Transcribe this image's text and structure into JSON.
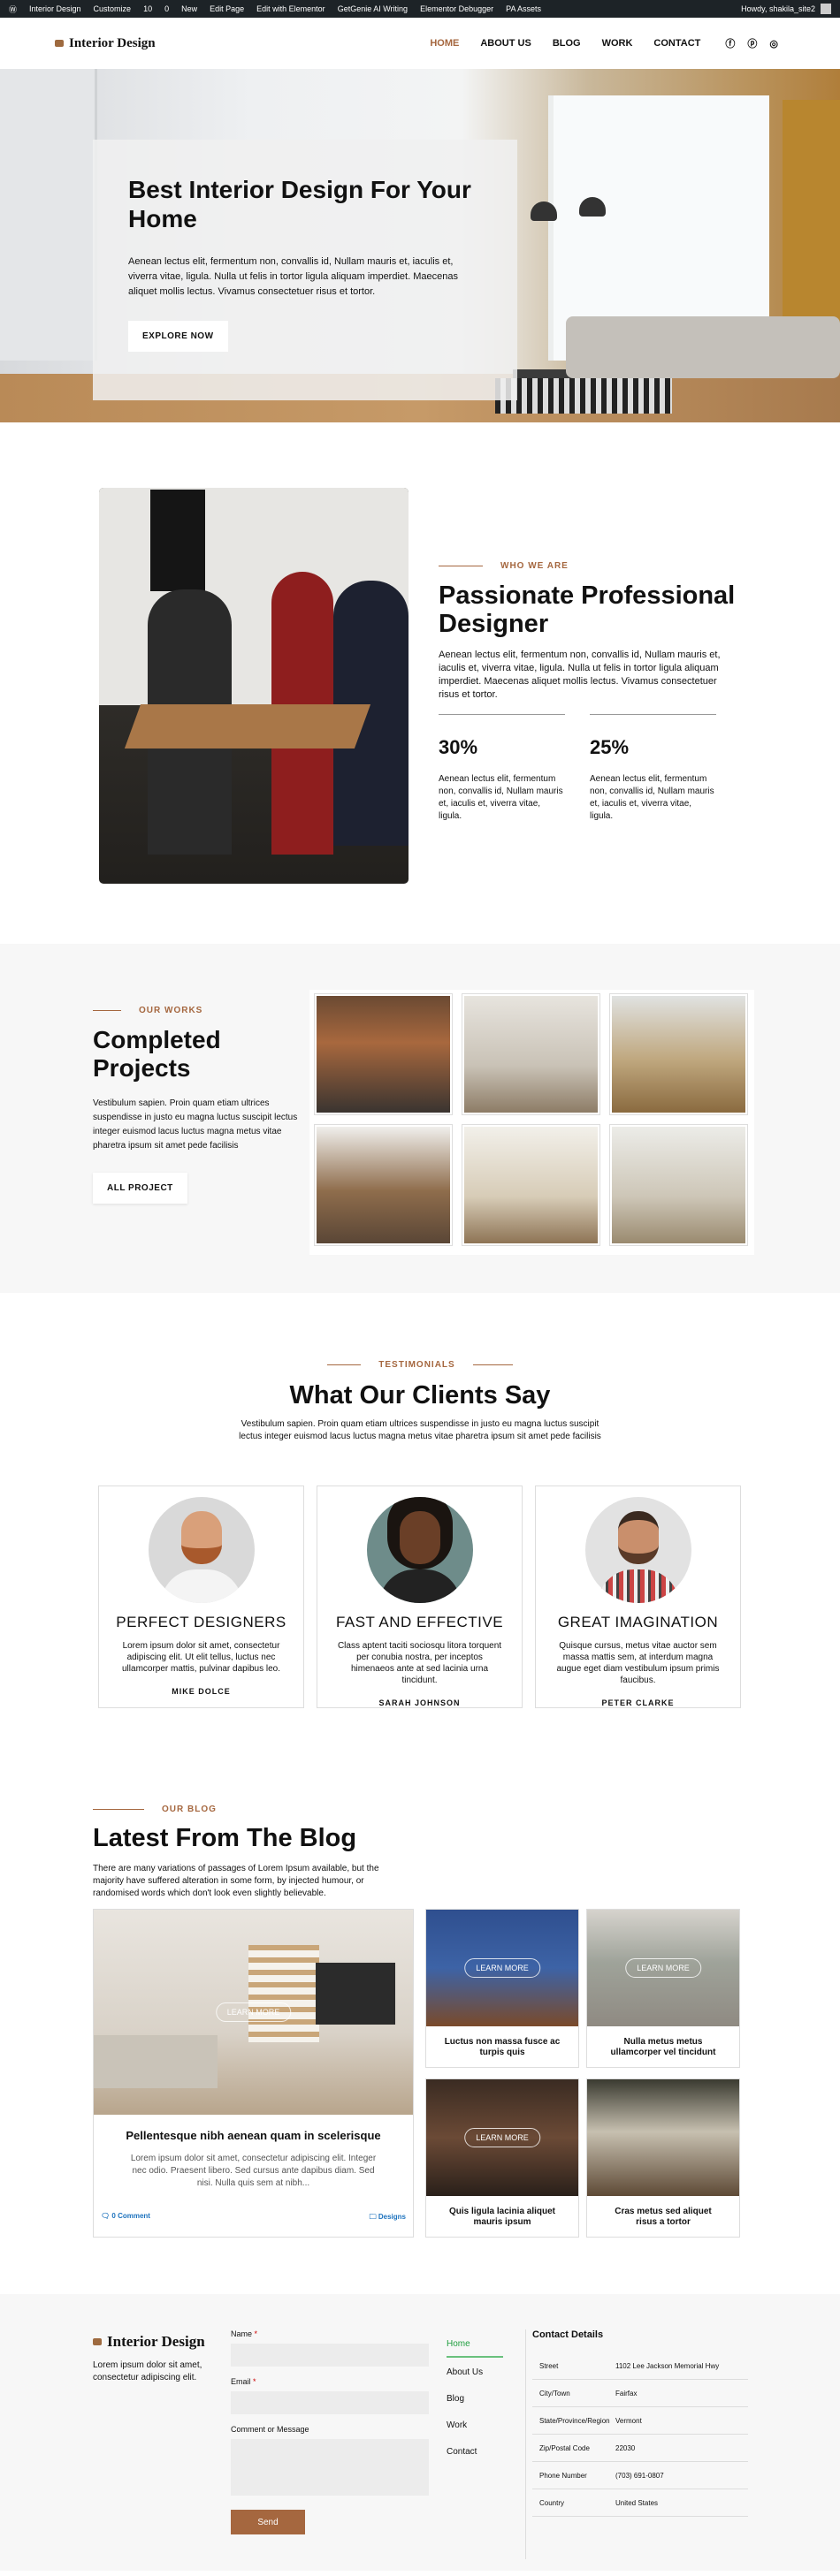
{
  "adminbar": {
    "items": [
      "Interior Design",
      "Customize",
      "10",
      "0",
      "New",
      "Edit Page",
      "Edit with Elementor",
      "GetGenie AI Writing",
      "Elementor Debugger",
      "PA Assets"
    ],
    "howdy": "Howdy, shakila_site2"
  },
  "nav": {
    "logo": "Interior Design",
    "items": [
      "HOME",
      "ABOUT US",
      "BLOG",
      "WORK",
      "CONTACT"
    ],
    "social": [
      "facebook-icon",
      "pinterest-icon",
      "instagram-icon"
    ]
  },
  "hero": {
    "title": "Best Interior Design For Your Home",
    "body": "Aenean lectus elit, fermentum non, convallis id, Nullam mauris et, iaculis et, viverra vitae, ligula. Nulla ut felis in tortor ligula aliquam imperdiet. Maecenas aliquet mollis lectus. Vivamus consectetuer risus et tortor.",
    "button": "EXPLORE NOW"
  },
  "about": {
    "eyebrow": "WHO WE ARE",
    "title": "Passionate Professional Designer",
    "body": "Aenean lectus elit, fermentum non, convallis id, Nullam mauris et, iaculis et, viverra vitae, ligula. Nulla ut felis in tortor ligula aliquam imperdiet. Maecenas aliquet mollis lectus. Vivamus consectetuer risus et tortor.",
    "stats": [
      {
        "num": "30%",
        "desc": "Aenean lectus elit, fermentum non, convallis id, Nullam mauris et, iaculis et, viverra vitae, ligula."
      },
      {
        "num": "25%",
        "desc": "Aenean lectus elit, fermentum non, convallis id, Nullam mauris et, iaculis et, viverra vitae, ligula."
      }
    ]
  },
  "works": {
    "eyebrow": "OUR WORKS",
    "title": "Completed Projects",
    "body": "Vestibulum sapien. Proin quam etiam ultrices suspendisse in justo eu magna luctus suscipit lectus integer euismod lacus luctus magna metus vitae pharetra ipsum sit amet pede facilisis",
    "button": "ALL PROJECT"
  },
  "testimonials": {
    "eyebrow": "TESTIMONIALS",
    "title": "What Our Clients Say",
    "sub": "Vestibulum sapien. Proin quam etiam ultrices suspendisse in justo eu magna luctus suscipit lectus integer euismod lacus luctus magna metus vitae pharetra ipsum sit amet pede facilisis",
    "cards": [
      {
        "title": "PERFECT DESIGNERS",
        "text": "Lorem ipsum dolor sit amet, consectetur adipiscing elit. Ut elit tellus, luctus nec ullamcorper mattis, pulvinar dapibus leo.",
        "name": "MIKE DOLCE"
      },
      {
        "title": "FAST AND EFFECTIVE",
        "text": "Class aptent taciti sociosqu litora torquent per conubia nostra, per inceptos himenaeos ante at sed lacinia urna tincidunt.",
        "name": "SARAH JOHNSON"
      },
      {
        "title": "GREAT IMAGINATION",
        "text": "Quisque cursus, metus vitae auctor sem massa mattis sem, at interdum magna augue eget diam vestibulum ipsum primis faucibus.",
        "name": "PETER CLARKE"
      }
    ]
  },
  "blog": {
    "eyebrow": "OUR BLOG",
    "title": "Latest From The Blog",
    "intro": "There are many variations of passages of Lorem Ipsum available, but the majority have suffered alteration in some form, by injected humour, or randomised words which don't look even slightly believable.",
    "more": "LEARN MORE",
    "featured": {
      "title": "Pellentesque nibh aenean quam in scelerisque",
      "excerpt": "Lorem ipsum dolor sit amet, consectetur adipiscing elit. Integer nec odio. Praesent libero. Sed cursus ante dapibus diam. Sed nisi. Nulla quis sem at nibh...",
      "comments": "0 Comment",
      "category": "Designs"
    },
    "posts": [
      {
        "title": "Luctus non massa fusce ac turpis quis"
      },
      {
        "title": "Nulla metus metus ullamcorper vel tincidunt"
      },
      {
        "title": "Quis ligula lacinia aliquet mauris ipsum"
      },
      {
        "title": "Cras metus sed aliquet risus a tortor"
      }
    ]
  },
  "footer": {
    "logo": "Interior Design",
    "tagline": "Lorem ipsum dolor sit amet, consectetur adipiscing elit.",
    "form": {
      "name": "Name",
      "email": "Email",
      "comment": "Comment or Message",
      "send": "Send",
      "required": "*"
    },
    "menu": [
      "Home",
      "About Us",
      "Blog",
      "Work",
      "Contact"
    ],
    "contact_title": "Contact Details",
    "contact": [
      {
        "k": "Street",
        "v": "1102 Lee Jackson Memorial Hwy"
      },
      {
        "k": "City/Town",
        "v": "Fairfax"
      },
      {
        "k": "State/Province/Region",
        "v": "Vermont"
      },
      {
        "k": "Zip/Postal Code",
        "v": "22030"
      },
      {
        "k": "Phone Number",
        "v": "(703) 691-0807"
      },
      {
        "k": "Country",
        "v": "United States"
      }
    ]
  }
}
